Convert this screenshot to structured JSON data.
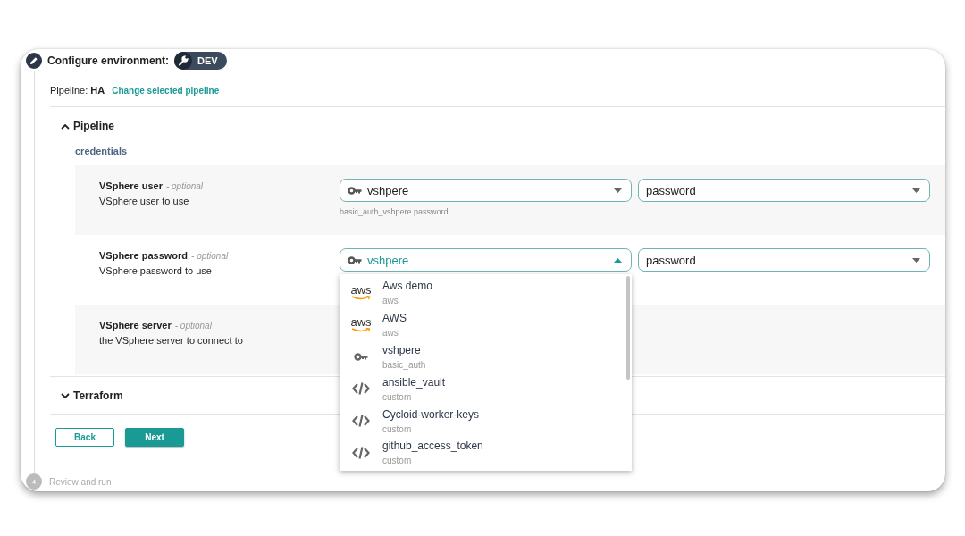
{
  "step": {
    "title": "Configure environment:",
    "env_badge": "DEV"
  },
  "pipeline": {
    "label": "Pipeline:",
    "name": "HA",
    "link": "Change selected pipeline"
  },
  "sections": [
    {
      "title": "Pipeline",
      "expanded": true,
      "group": "credentials",
      "fields": [
        {
          "name": "VSphere user",
          "optional": "- optional",
          "description": "VSphere user to use",
          "credential": {
            "value": "vshpere",
            "open": false
          },
          "key": {
            "value": "password"
          },
          "hint": "basic_auth_vshpere.password"
        },
        {
          "name": "VSphere password",
          "optional": "- optional",
          "description": "VSphere password to use",
          "credential": {
            "value": "vshpere",
            "open": true,
            "options": [
              {
                "kind": "aws",
                "logo": "aws",
                "name": "Aws demo",
                "type": "aws"
              },
              {
                "kind": "aws",
                "logo": "aws",
                "name": "AWS",
                "type": "aws"
              },
              {
                "kind": "key",
                "name": "vshpere",
                "type": "basic_auth"
              },
              {
                "kind": "code",
                "name": "ansible_vault",
                "type": "custom"
              },
              {
                "kind": "code",
                "name": "Cycloid-worker-keys",
                "type": "custom"
              },
              {
                "kind": "code",
                "name": "github_access_token",
                "type": "custom"
              }
            ]
          },
          "key": {
            "value": "password"
          }
        },
        {
          "name": "VSphere server",
          "optional": "- optional",
          "description": "the VSphere server to connect to"
        }
      ]
    },
    {
      "title": "Terraform",
      "expanded": false
    }
  ],
  "buttons": [
    {
      "label": "Back",
      "kind": "secondary"
    },
    {
      "label": "Next",
      "kind": "primary"
    }
  ],
  "next_step": {
    "number": "4",
    "label": "Review and run"
  }
}
